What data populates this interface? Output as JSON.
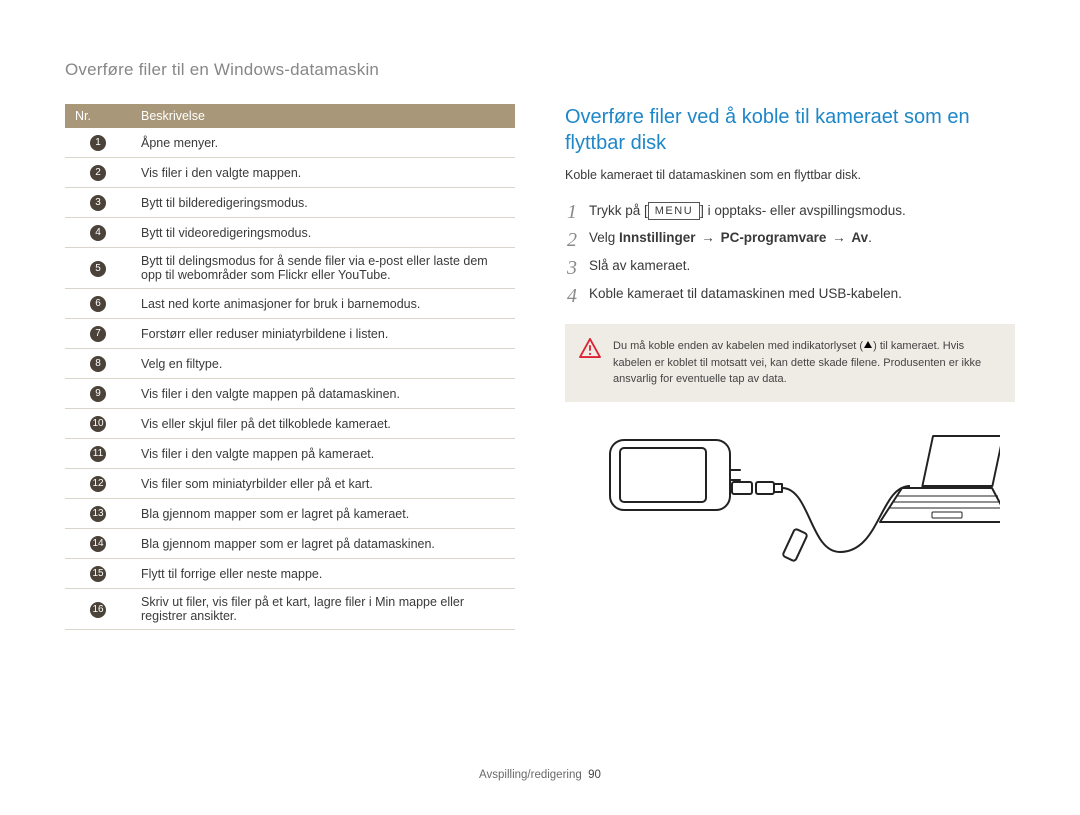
{
  "breadcrumb": "Overføre filer til en Windows-datamaskin",
  "table": {
    "headers": {
      "num": "Nr.",
      "desc": "Beskrivelse"
    },
    "rows": [
      {
        "n": "1",
        "d": "Åpne menyer."
      },
      {
        "n": "2",
        "d": "Vis filer i den valgte mappen."
      },
      {
        "n": "3",
        "d": "Bytt til bilderedigeringsmodus."
      },
      {
        "n": "4",
        "d": "Bytt til videoredigeringsmodus."
      },
      {
        "n": "5",
        "d": "Bytt til delingsmodus for å sende filer via e-post eller laste dem opp til webområder som Flickr eller YouTube."
      },
      {
        "n": "6",
        "d": "Last ned korte animasjoner for bruk i barnemodus."
      },
      {
        "n": "7",
        "d": "Forstørr eller reduser miniatyrbildene i listen."
      },
      {
        "n": "8",
        "d": "Velg en filtype."
      },
      {
        "n": "9",
        "d": "Vis filer i den valgte mappen på datamaskinen."
      },
      {
        "n": "10",
        "d": "Vis eller skjul filer på det tilkoblede kameraet."
      },
      {
        "n": "11",
        "d": "Vis filer i den valgte mappen på kameraet."
      },
      {
        "n": "12",
        "d": "Vis filer som miniatyrbilder eller på et kart."
      },
      {
        "n": "13",
        "d": "Bla gjennom mapper som er lagret på kameraet."
      },
      {
        "n": "14",
        "d": "Bla gjennom mapper som er lagret på datamaskinen."
      },
      {
        "n": "15",
        "d": "Flytt til forrige eller neste mappe."
      },
      {
        "n": "16",
        "d": "Skriv ut filer, vis filer på et kart, lagre filer i Min mappe eller registrer ansikter."
      }
    ]
  },
  "section_title": "Overføre filer ved å koble til kameraet som en flyttbar disk",
  "intro": "Koble kameraet til datamaskinen som en flyttbar disk.",
  "steps": {
    "s1_pre": "Trykk på [",
    "s1_key": "MENU",
    "s1_post": "] i opptaks- eller avspillingsmodus.",
    "s2_pre": "Velg ",
    "s2_b1": "Innstillinger",
    "s2_b2": "PC-programvare",
    "s2_b3": "Av",
    "s3": "Slå av kameraet.",
    "s4": "Koble kameraet til datamaskinen med USB-kabelen."
  },
  "warning_text": "Du må koble enden av kabelen med indikatorlyset (▲) til kameraet. Hvis kabelen er koblet til motsatt vei, kan dette skade filene. Produsenten er ikke ansvarlig for eventuelle tap av data.",
  "warning_pre": "Du må koble enden av kabelen med indikatorlyset (",
  "warning_post": ") til kameraet. Hvis kabelen er koblet til motsatt vei, kan dette skade filene. Produsenten er ikke ansvarlig for eventuelle tap av data.",
  "footer": {
    "section": "Avspilling/redigering",
    "page": "90"
  }
}
